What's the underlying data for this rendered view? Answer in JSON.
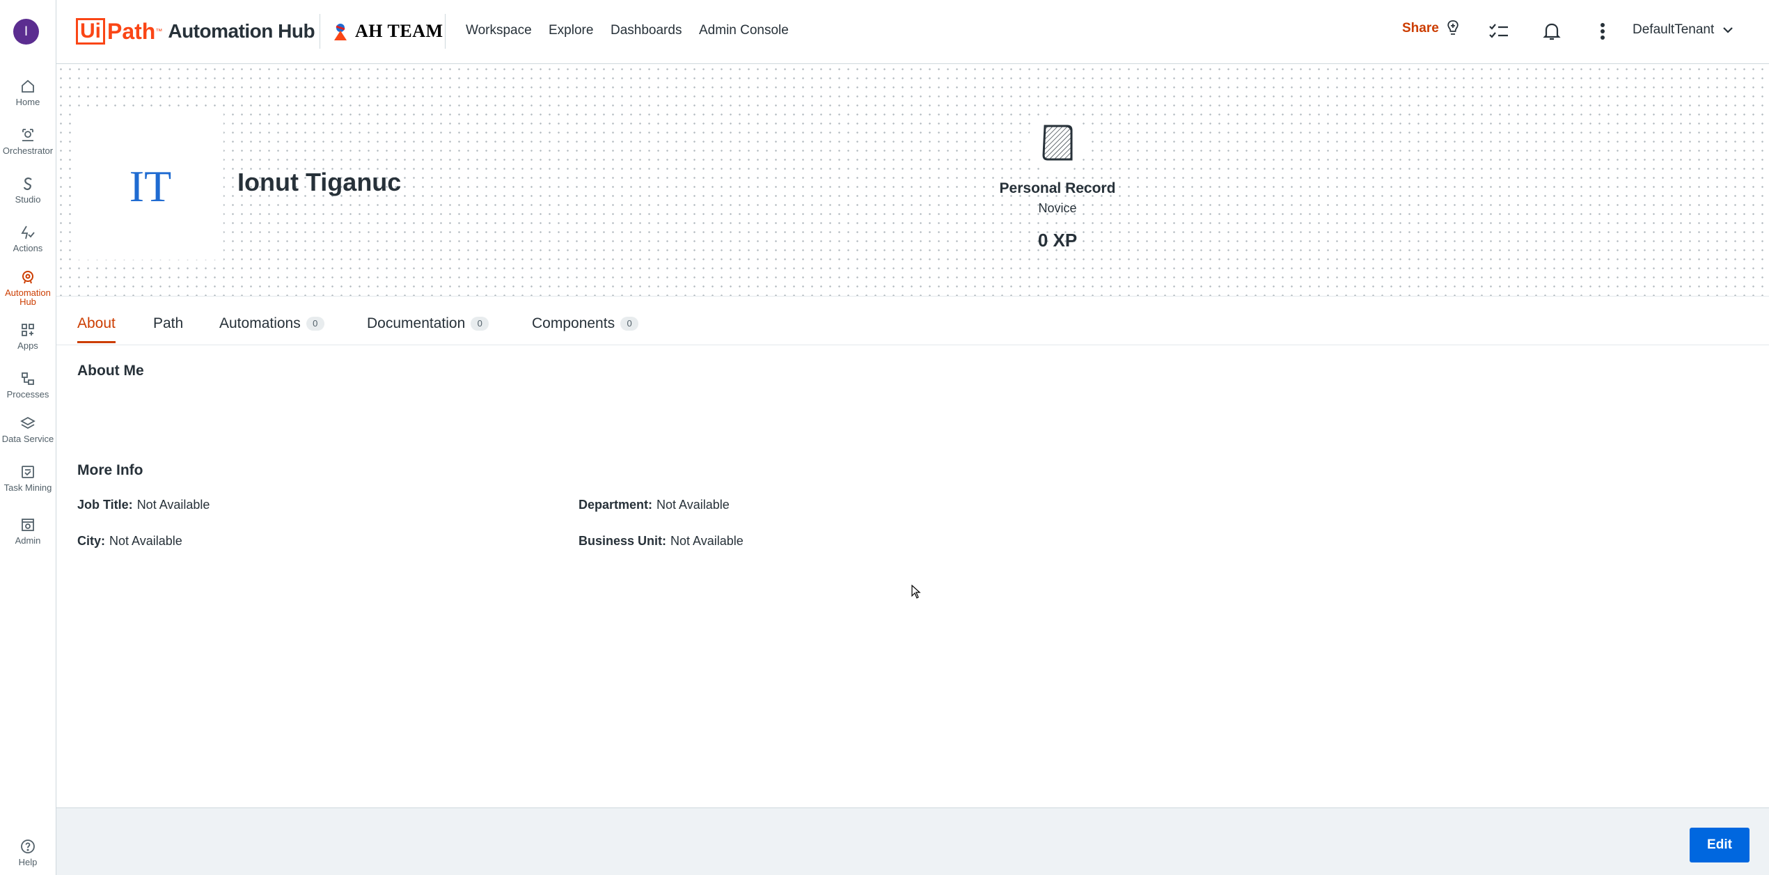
{
  "user": {
    "avatar_letter": "I",
    "initials": "IT",
    "name": "Ionut Tiganuc"
  },
  "rail": {
    "items": [
      {
        "label": "Home",
        "icon": "home-icon"
      },
      {
        "label": "Orchestrator",
        "icon": "orchestrator-icon"
      },
      {
        "label": "Studio",
        "icon": "studio-icon"
      },
      {
        "label": "Actions",
        "icon": "actions-icon"
      },
      {
        "label": "Automation Hub",
        "icon": "automation-hub-icon",
        "active": true
      },
      {
        "label": "Apps",
        "icon": "apps-icon"
      },
      {
        "label": "Processes",
        "icon": "processes-icon"
      },
      {
        "label": "Data Service",
        "icon": "data-service-icon"
      },
      {
        "label": "Task Mining",
        "icon": "task-mining-icon"
      },
      {
        "label": "Admin",
        "icon": "admin-icon"
      }
    ],
    "help_label": "Help"
  },
  "header": {
    "logo_ui": "Ui",
    "logo_path": "Path",
    "logo_tm": "™",
    "logo_product": "Automation Hub",
    "team_name": "AH TEAM",
    "nav": [
      "Workspace",
      "Explore",
      "Dashboards",
      "Admin Console"
    ],
    "share_label": "Share",
    "tenant": "DefaultTenant"
  },
  "record": {
    "title": "Personal Record",
    "rank": "Novice",
    "xp": "0 XP"
  },
  "tabs": [
    {
      "label": "About",
      "active": true
    },
    {
      "label": "Path"
    },
    {
      "label": "Automations",
      "count": "0"
    },
    {
      "label": "Documentation",
      "count": "0"
    },
    {
      "label": "Components",
      "count": "0"
    }
  ],
  "about": {
    "title": "About Me",
    "more_info_title": "More Info",
    "fields": {
      "job_title": {
        "label": "Job Title:",
        "value": "Not Available"
      },
      "department": {
        "label": "Department:",
        "value": "Not Available"
      },
      "city": {
        "label": "City:",
        "value": "Not Available"
      },
      "business_unit": {
        "label": "Business Unit:",
        "value": "Not Available"
      }
    }
  },
  "footer": {
    "edit_label": "Edit"
  },
  "colors": {
    "accent": "#cc3d00",
    "brand": "#fa4616",
    "primary_button": "#0067df",
    "avatar": "#5b2d90",
    "initials": "#1f6bd1"
  }
}
